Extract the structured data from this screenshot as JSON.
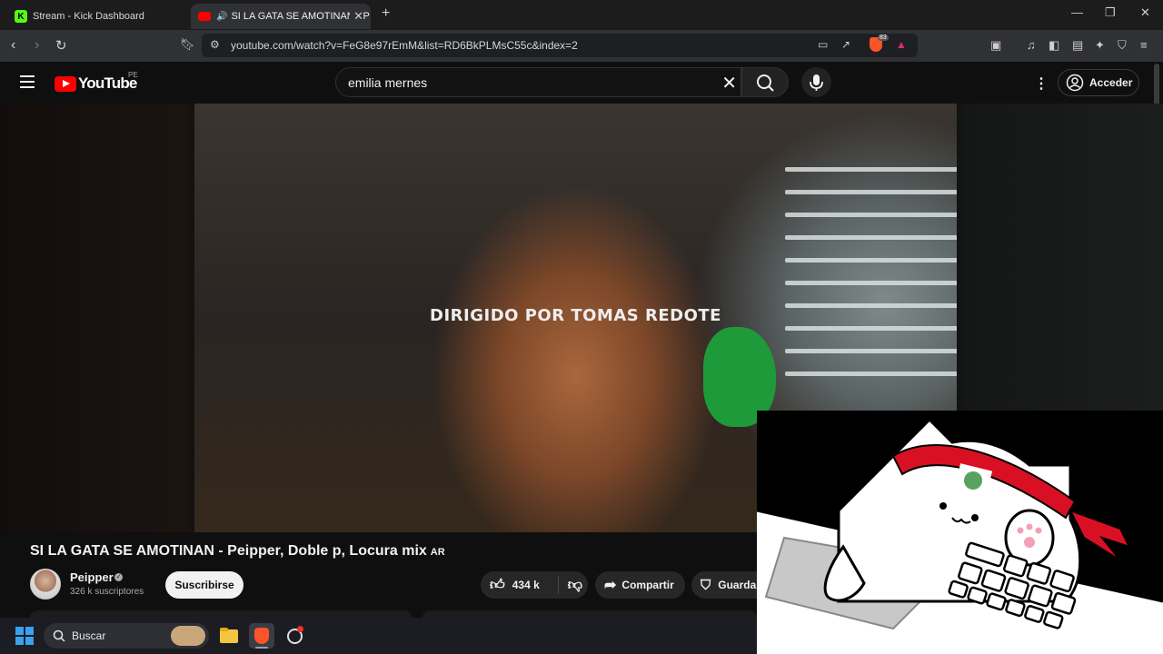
{
  "browser": {
    "tabs": [
      {
        "title": "Stream - Kick Dashboard",
        "favicon_color": "#53fc18",
        "favicon_letter": "K"
      },
      {
        "title": "SI LA GATA SE AMOTINAN - P",
        "favicon_color": "#ff0000",
        "audio": true
      }
    ],
    "new_tab": "+",
    "window_controls": {
      "minimize": "—",
      "restore": "❐",
      "close": "✕"
    },
    "url": "youtube.com/watch?v=FeG8e97rEmM&list=RD6BkPLMsC55c&index=2",
    "brave_shield_count": "83"
  },
  "youtube": {
    "logo_text": "YouTube",
    "country": "PE",
    "search": {
      "value": "emilia mernes"
    },
    "sign_in": "Acceder"
  },
  "video": {
    "overlay_text": "DIRIGIDO POR TOMAS REDOTE",
    "title": "SI LA GATA SE AMOTINAN - Peipper, Doble p, Locura mix",
    "title_tag": "AR",
    "channel": {
      "name": "Peipper",
      "subscribers": "326 k suscriptores"
    },
    "subscribe_label": "Suscribirse",
    "likes": "434 k",
    "share_label": "Compartir",
    "save_label": "Guardar"
  },
  "taskbar": {
    "search_placeholder": "Buscar"
  },
  "colors": {
    "youtube_red": "#ff0000",
    "kick_green": "#53fc18",
    "peru_red": "#d91023"
  }
}
